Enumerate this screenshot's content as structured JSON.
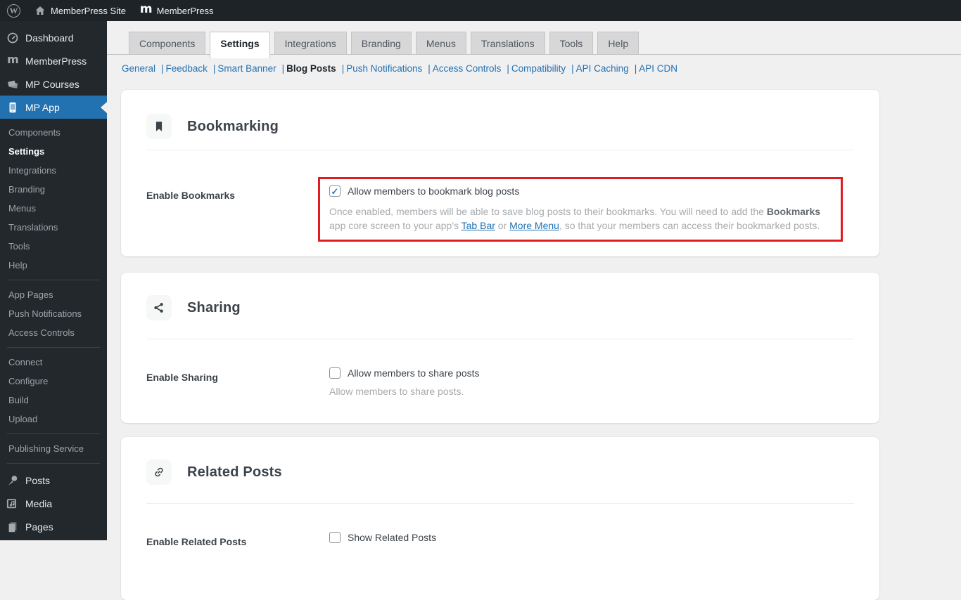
{
  "admin_bar": {
    "wp_logo": "W",
    "site_name": "MemberPress Site",
    "plugin_name": "MemberPress"
  },
  "sidebar": {
    "items": [
      "Dashboard",
      "MemberPress",
      "MP Courses",
      "MP App"
    ],
    "active_item": "MP App",
    "app_submenu": [
      "Components",
      "Settings",
      "Integrations",
      "Branding",
      "Menus",
      "Translations",
      "Tools",
      "Help"
    ],
    "active_submenu": "Settings",
    "pages_submenu": [
      "App Pages",
      "Push Notifications",
      "Access Controls"
    ],
    "build_submenu": [
      "Connect",
      "Configure",
      "Build",
      "Upload"
    ],
    "service_submenu": [
      "Publishing Service"
    ],
    "bottom_items": [
      "Posts",
      "Media",
      "Pages"
    ]
  },
  "tabs": {
    "items": [
      "Components",
      "Settings",
      "Integrations",
      "Branding",
      "Menus",
      "Translations",
      "Tools",
      "Help"
    ],
    "active": "Settings"
  },
  "subnav": {
    "items": [
      "General",
      "Feedback",
      "Smart Banner",
      "Blog Posts",
      "Push Notifications",
      "Access Controls",
      "Compatibility",
      "API Caching",
      "API CDN"
    ],
    "active": "Blog Posts",
    "separator": "|"
  },
  "bookmarking": {
    "title": "Bookmarking",
    "label": "Enable Bookmarks",
    "checkbox_label": "Allow members to bookmark blog posts",
    "checked": true,
    "desc_pre": "Once enabled, members will be able to save blog posts to their bookmarks. You will need to add the ",
    "desc_bold": "Bookmarks",
    "desc_mid": " app core screen to your app's ",
    "link_tab_bar": "Tab Bar",
    "desc_or": " or ",
    "link_more_menu": "More Menu",
    "desc_post": ", so that your members can access their bookmarked posts."
  },
  "sharing": {
    "title": "Sharing",
    "label": "Enable Sharing",
    "checkbox_label": "Allow members to share posts",
    "checked": false,
    "description": "Allow members to share posts."
  },
  "related_posts": {
    "title": "Related Posts",
    "label": "Enable Related Posts",
    "checkbox_label": "Show Related Posts",
    "checked": false
  },
  "colors": {
    "accent_blue": "#2271b1",
    "highlight_red": "#e01d23",
    "admin_bar_bg": "#1d2327",
    "sidebar_bg": "#23282d",
    "content_bg": "#f0f0f1"
  }
}
